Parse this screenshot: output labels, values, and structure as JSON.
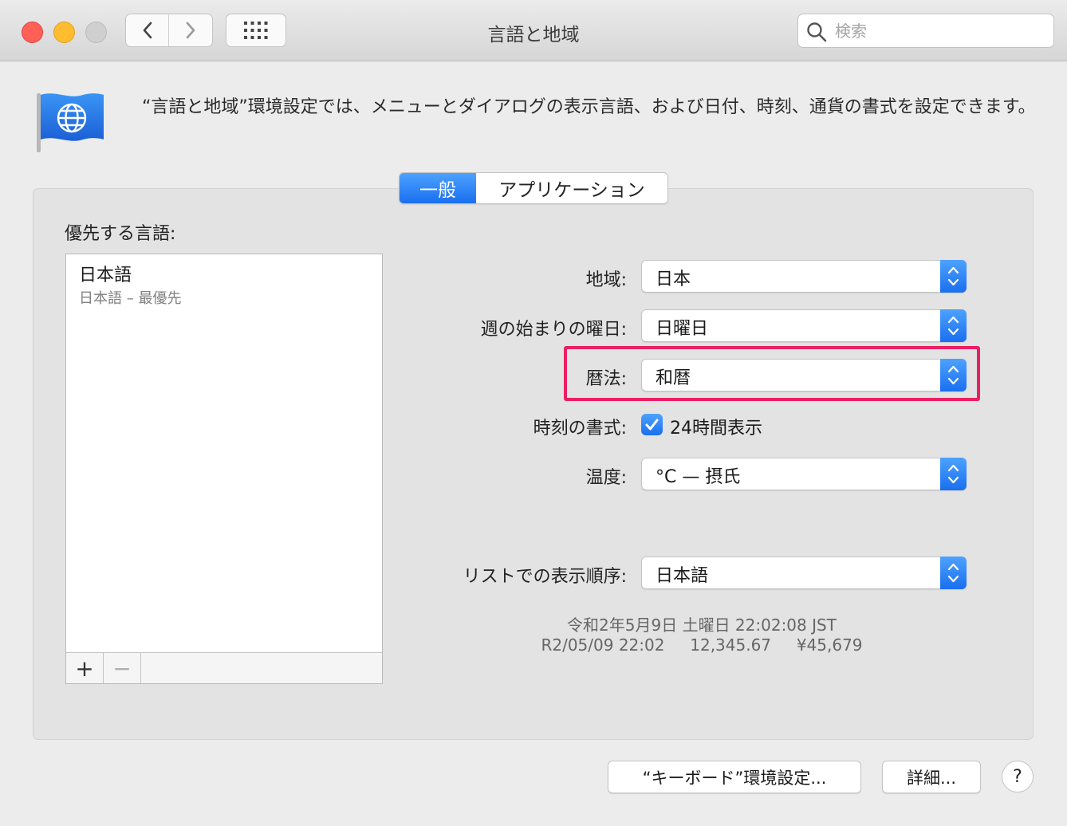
{
  "window": {
    "title": "言語と地域"
  },
  "search": {
    "placeholder": "検索"
  },
  "description": "“言語と地域”環境設定では、メニューとダイアログの表示言語、および日付、時刻、通貨の書式を設定できます。",
  "tabs": [
    {
      "label": "一般",
      "selected": true
    },
    {
      "label": "アプリケーション",
      "selected": false
    }
  ],
  "preferred_languages": {
    "label": "優先する言語:",
    "items": [
      {
        "title": "日本語",
        "subtitle": "日本語 – 最優先"
      }
    ],
    "add_label": "+",
    "remove_label": "−"
  },
  "settings": {
    "region": {
      "label": "地域:",
      "value": "日本"
    },
    "first_day": {
      "label": "週の始まりの曜日:",
      "value": "日曜日"
    },
    "calendar": {
      "label": "暦法:",
      "value": "和暦"
    },
    "time_format": {
      "label": "時刻の書式:",
      "checkbox_label": "24時間表示",
      "checked": true
    },
    "temperature": {
      "label": "温度:",
      "value": "°C — 摂氏"
    },
    "list_order": {
      "label": "リストでの表示順序:",
      "value": "日本語"
    }
  },
  "sample": {
    "line1": "令和2年5月9日 土曜日 22:02:08 JST",
    "line2": "R2/05/09 22:02     12,345.67     ¥45,679"
  },
  "buttons": {
    "keyboard": "“キーボード”環境設定...",
    "advanced": "詳細...",
    "help": "?"
  },
  "colors": {
    "accent": "#1a6fef",
    "highlight": "#ea1f63"
  }
}
